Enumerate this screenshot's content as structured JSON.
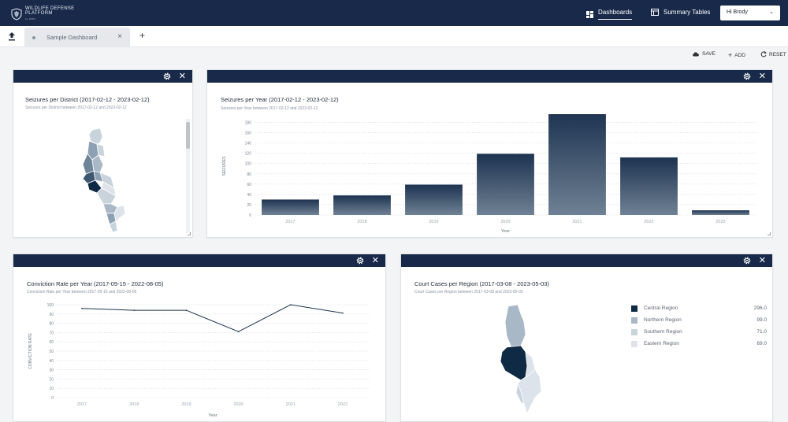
{
  "app": {
    "logo_line1": "WILDLIFE DEFENSE",
    "logo_line2": "PLATFORM",
    "logo_sub": "by WWF"
  },
  "nav": {
    "dashboards": "Dashboards",
    "summary_tables": "Summary Tables",
    "user": "Hi Brody"
  },
  "tabs": [
    {
      "label": "Sample Dashboard"
    }
  ],
  "actions": {
    "save": "SAVE",
    "add": "ADD",
    "reset": "RESET"
  },
  "colors": {
    "navy": "#18294a",
    "central": "#0f2a44",
    "northern": "#a9b8c6",
    "southern": "#c9d3dc",
    "eastern": "#dce3ea"
  },
  "panels": {
    "district": {
      "title": "Seizures per District (2017-02-12 - 2023-02-12)",
      "subtitle": "Seizures per District between 2017-02-12 and 2023-02-12"
    },
    "seizures_year": {
      "title": "Seizures per Year (2017-02-12 - 2023-02-12)",
      "subtitle": "Seizures per Year between 2017-02-12 and 2023-02-12",
      "chart_data": {
        "type": "bar",
        "categories": [
          "2017",
          "2018",
          "2019",
          "2020",
          "2021",
          "2022",
          "2023"
        ],
        "values": [
          30,
          38,
          59,
          119,
          200,
          112,
          9
        ],
        "xlabel": "Year",
        "ylabel": "SEIZURES",
        "ylim": [
          0,
          190
        ],
        "yticks": [
          0,
          20,
          40,
          60,
          80,
          100,
          120,
          140,
          160,
          180
        ],
        "grid": true
      }
    },
    "conviction": {
      "title": "Conviction Rate per Year (2017-09-15 - 2022-08-05)",
      "subtitle": "Conviction Rate per Year between 2017-09-15 and 2022-08-05",
      "chart_data": {
        "type": "line",
        "x": [
          "2017",
          "2018",
          "2019",
          "2020",
          "2021",
          "2022"
        ],
        "values": [
          96,
          94,
          94,
          71,
          100,
          91
        ],
        "xlabel": "Year",
        "ylabel": "CONVICTION RATE",
        "ylim": [
          0,
          100
        ],
        "yticks": [
          0,
          10,
          20,
          30,
          40,
          50,
          60,
          70,
          80,
          90,
          100
        ],
        "grid": true
      }
    },
    "court_cases": {
      "title": "Court Cases per Region (2017-03-08 - 2023-05-03)",
      "subtitle": "Court Cases per Region between 2017-03-08 and 2023-05-03",
      "legend": [
        {
          "name": "Central Region",
          "value": "296.0",
          "color": "#0f2a44"
        },
        {
          "name": "Northern Region",
          "value": "99.0",
          "color": "#a9b8c6"
        },
        {
          "name": "Southern Region",
          "value": "71.0",
          "color": "#c9d3dc"
        },
        {
          "name": "Eastern Region",
          "value": "69.0",
          "color": "#dce3ea"
        }
      ]
    }
  }
}
